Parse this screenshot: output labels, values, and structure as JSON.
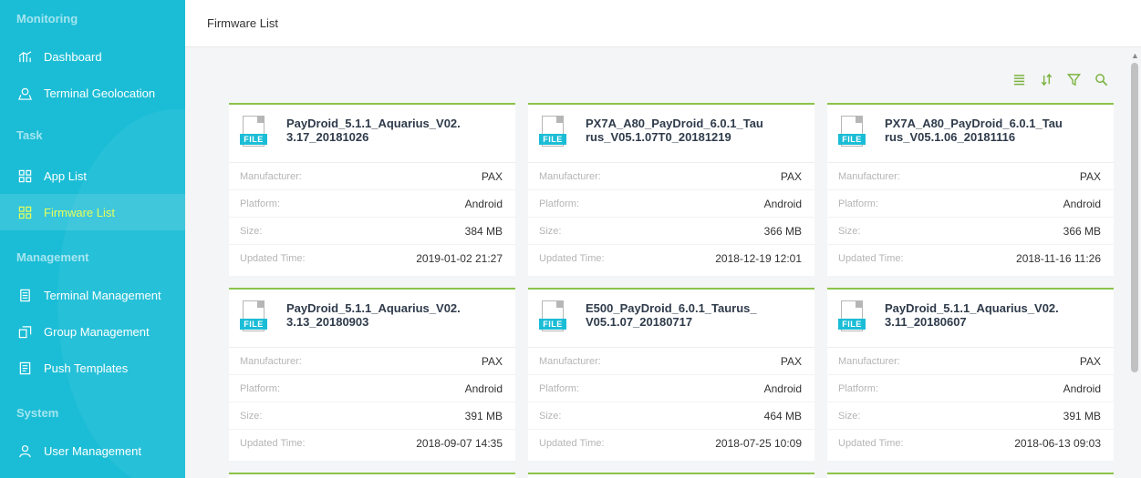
{
  "sidebar": {
    "sections": [
      {
        "title": "Monitoring",
        "items": [
          {
            "label": "Dashboard",
            "icon": "dashboard-icon"
          },
          {
            "label": "Terminal Geolocation",
            "icon": "geolocation-icon"
          }
        ]
      },
      {
        "title": "Task",
        "items": [
          {
            "label": "App List",
            "icon": "app-grid-icon"
          },
          {
            "label": "Firmware List",
            "icon": "firmware-grid-icon",
            "active": true
          }
        ]
      },
      {
        "title": "Management",
        "items": [
          {
            "label": "Terminal Management",
            "icon": "terminal-icon"
          },
          {
            "label": "Group Management",
            "icon": "group-icon"
          },
          {
            "label": "Push Templates",
            "icon": "template-icon"
          }
        ]
      },
      {
        "title": "System",
        "items": [
          {
            "label": "User Management",
            "icon": "user-icon"
          }
        ]
      }
    ]
  },
  "header": {
    "title": "Firmware List"
  },
  "labels": {
    "file_tag": "FILE",
    "manufacturer": "Manufacturer:",
    "platform": "Platform:",
    "size": "Size:",
    "updated": "Updated Time:"
  },
  "toolbar": {
    "icons": [
      "list-view-icon",
      "sort-icon",
      "filter-icon",
      "search-icon"
    ]
  },
  "colors": {
    "sidebar": "#1bbdd6",
    "accent": "#8bc34a",
    "active_text": "#e6ff5a"
  },
  "firmware": [
    {
      "name": "PayDroid_5.1.1_Aquarius_V02.3.17_20181026",
      "manufacturer": "PAX",
      "platform": "Android",
      "size": "384 MB",
      "updated": "2019-01-02 21:27"
    },
    {
      "name": "PX7A_A80_PayDroid_6.0.1_Taurus_V05.1.07T0_20181219",
      "manufacturer": "PAX",
      "platform": "Android",
      "size": "366 MB",
      "updated": "2018-12-19 12:01"
    },
    {
      "name": "PX7A_A80_PayDroid_6.0.1_Taurus_V05.1.06_20181116",
      "manufacturer": "PAX",
      "platform": "Android",
      "size": "366 MB",
      "updated": "2018-11-16 11:26"
    },
    {
      "name": "PayDroid_5.1.1_Aquarius_V02.3.13_20180903",
      "manufacturer": "PAX",
      "platform": "Android",
      "size": "391 MB",
      "updated": "2018-09-07 14:35"
    },
    {
      "name": "E500_PayDroid_6.0.1_Taurus_V05.1.07_20180717",
      "manufacturer": "PAX",
      "platform": "Android",
      "size": "464 MB",
      "updated": "2018-07-25 10:09"
    },
    {
      "name": "PayDroid_5.1.1_Aquarius_V02.3.11_20180607",
      "manufacturer": "PAX",
      "platform": "Android",
      "size": "391 MB",
      "updated": "2018-06-13 09:03"
    }
  ]
}
